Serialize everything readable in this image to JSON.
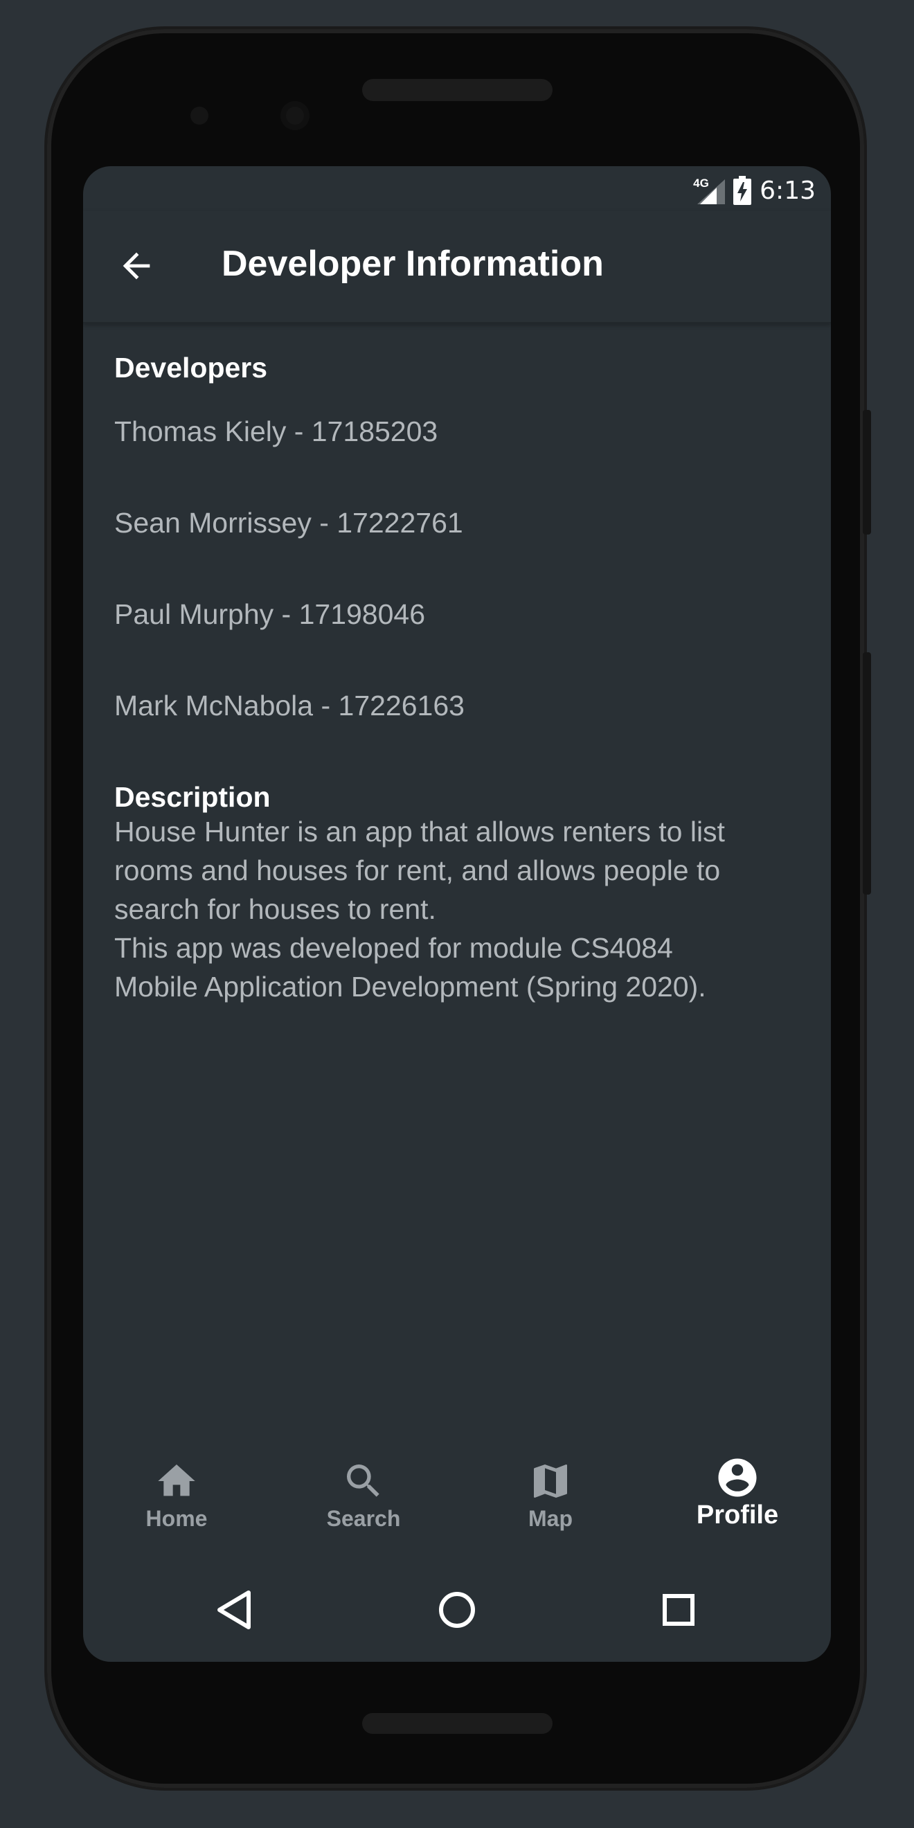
{
  "status": {
    "network": "4G",
    "time": "6:13"
  },
  "appbar": {
    "title": "Developer Information"
  },
  "developers": {
    "title": "Developers",
    "items": [
      "Thomas Kiely - 17185203",
      "Sean Morrissey - 17222761",
      "Paul Murphy - 17198046",
      "Mark McNabola - 17226163"
    ]
  },
  "description": {
    "title": "Description",
    "body": "House Hunter is an app that allows renters to list\nrooms and houses for rent, and allows people to\nsearch for houses to rent.\nThis app was developed for module CS4084\nMobile Application Development (Spring 2020)."
  },
  "bottom_nav": {
    "items": [
      {
        "label": "Home",
        "icon": "home-icon"
      },
      {
        "label": "Search",
        "icon": "search-icon"
      },
      {
        "label": "Map",
        "icon": "map-icon"
      },
      {
        "label": "Profile",
        "icon": "account-circle-icon"
      }
    ],
    "active_index": 3
  },
  "system_nav": {
    "icons": [
      "back-triangle-icon",
      "home-circle-icon",
      "recents-square-icon"
    ]
  },
  "colors": {
    "background": "#293035",
    "text_primary": "#ffffff",
    "text_secondary": "#b3b8bc",
    "nav_inactive": "#9aa0a5"
  }
}
